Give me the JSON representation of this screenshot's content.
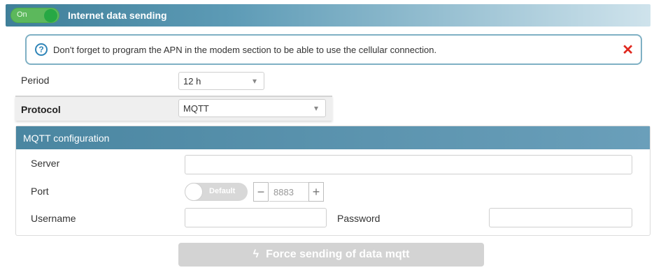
{
  "header": {
    "toggle_label": "On",
    "title": "Internet data sending"
  },
  "alert": {
    "icon": "question-circle-icon",
    "text": "Don't forget to program the APN in the modem section to be able to use the cellular connection."
  },
  "period": {
    "label": "Period",
    "value": "12 h"
  },
  "protocol": {
    "label": "Protocol",
    "value": "MQTT"
  },
  "mqtt": {
    "title": "MQTT configuration",
    "server_label": "Server",
    "server_value": "",
    "port_label": "Port",
    "port_toggle_label": "Default",
    "port_value": "8883",
    "username_label": "Username",
    "username_value": "",
    "password_label": "Password",
    "password_value": ""
  },
  "force_button": {
    "label": "Force sending of data mqtt",
    "icon": "bolt-icon"
  },
  "colors": {
    "accent": "#4a86a1",
    "toggle_on": "#5cb85c",
    "close": "#e0281e"
  }
}
